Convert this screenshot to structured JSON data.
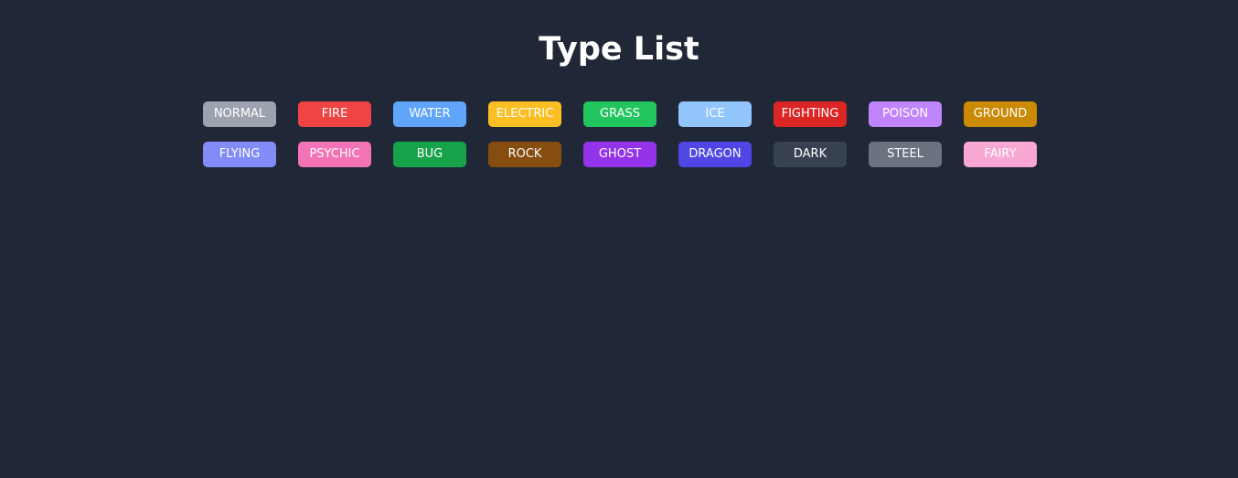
{
  "page": {
    "title": "Type List",
    "background": "#202837"
  },
  "types": [
    {
      "label": "NORMAL",
      "color": "#9ca3af"
    },
    {
      "label": "FIRE",
      "color": "#ef4444"
    },
    {
      "label": "WATER",
      "color": "#60a5fa"
    },
    {
      "label": "ELECTRIC",
      "color": "#fbbf24"
    },
    {
      "label": "GRASS",
      "color": "#22c55e"
    },
    {
      "label": "ICE",
      "color": "#93c5fd"
    },
    {
      "label": "FIGHTING",
      "color": "#dc2626"
    },
    {
      "label": "POISON",
      "color": "#c084fc"
    },
    {
      "label": "GROUND",
      "color": "#ca8a04"
    },
    {
      "label": "FLYING",
      "color": "#818cf8"
    },
    {
      "label": "PSYCHIC",
      "color": "#f472b6"
    },
    {
      "label": "BUG",
      "color": "#16a34a"
    },
    {
      "label": "ROCK",
      "color": "#854d0e"
    },
    {
      "label": "GHOST",
      "color": "#9333ea"
    },
    {
      "label": "DRAGON",
      "color": "#4f46e5"
    },
    {
      "label": "DARK",
      "color": "#374151"
    },
    {
      "label": "STEEL",
      "color": "#6b7280"
    },
    {
      "label": "FAIRY",
      "color": "#f9a8d4"
    }
  ]
}
